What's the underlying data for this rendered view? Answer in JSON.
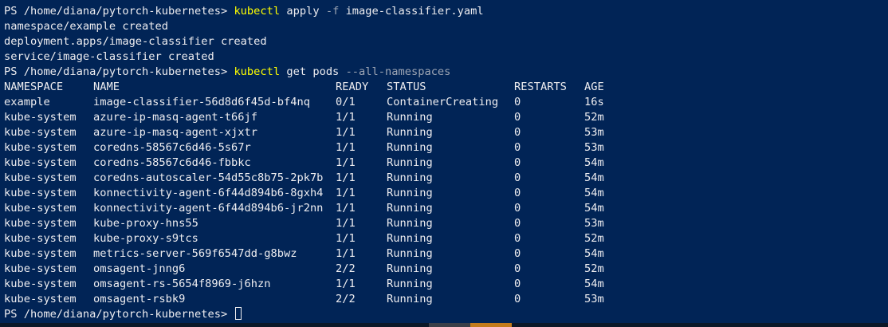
{
  "terminal": {
    "background": "#012456",
    "foreground": "#eeedf0",
    "command_color": "#ffff00",
    "parameter_color": "#9da5b4",
    "prompt": "PS /home/diana/pytorch-kubernetes>",
    "apply_command": {
      "cmd": "kubectl",
      "arg1": "apply",
      "param": "-f",
      "arg2": "image-classifier.yaml"
    },
    "apply_output": [
      "namespace/example created",
      "deployment.apps/image-classifier created",
      "service/image-classifier created"
    ],
    "get_command": {
      "cmd": "kubectl",
      "arg1": "get pods",
      "param": "--all-namespaces"
    },
    "headers": [
      "NAMESPACE",
      "NAME",
      "READY",
      "STATUS",
      "RESTARTS",
      "AGE"
    ],
    "rows": [
      [
        "example",
        "image-classifier-56d8d6f45d-bf4nq",
        "0/1",
        "ContainerCreating",
        "0",
        "16s"
      ],
      [
        "kube-system",
        "azure-ip-masq-agent-t66jf",
        "1/1",
        "Running",
        "0",
        "52m"
      ],
      [
        "kube-system",
        "azure-ip-masq-agent-xjxtr",
        "1/1",
        "Running",
        "0",
        "53m"
      ],
      [
        "kube-system",
        "coredns-58567c6d46-5s67r",
        "1/1",
        "Running",
        "0",
        "53m"
      ],
      [
        "kube-system",
        "coredns-58567c6d46-fbbkc",
        "1/1",
        "Running",
        "0",
        "54m"
      ],
      [
        "kube-system",
        "coredns-autoscaler-54d55c8b75-2pk7b",
        "1/1",
        "Running",
        "0",
        "54m"
      ],
      [
        "kube-system",
        "konnectivity-agent-6f44d894b6-8gxh4",
        "1/1",
        "Running",
        "0",
        "54m"
      ],
      [
        "kube-system",
        "konnectivity-agent-6f44d894b6-jr2nn",
        "1/1",
        "Running",
        "0",
        "54m"
      ],
      [
        "kube-system",
        "kube-proxy-hns55",
        "1/1",
        "Running",
        "0",
        "53m"
      ],
      [
        "kube-system",
        "kube-proxy-s9tcs",
        "1/1",
        "Running",
        "0",
        "52m"
      ],
      [
        "kube-system",
        "metrics-server-569f6547dd-g8bwz",
        "1/1",
        "Running",
        "0",
        "54m"
      ],
      [
        "kube-system",
        "omsagent-jnng6",
        "2/2",
        "Running",
        "0",
        "52m"
      ],
      [
        "kube-system",
        "omsagent-rs-5654f8969-j6hzn",
        "1/1",
        "Running",
        "0",
        "54m"
      ],
      [
        "kube-system",
        "omsagent-rsbk9",
        "2/2",
        "Running",
        "0",
        "53m"
      ]
    ]
  }
}
